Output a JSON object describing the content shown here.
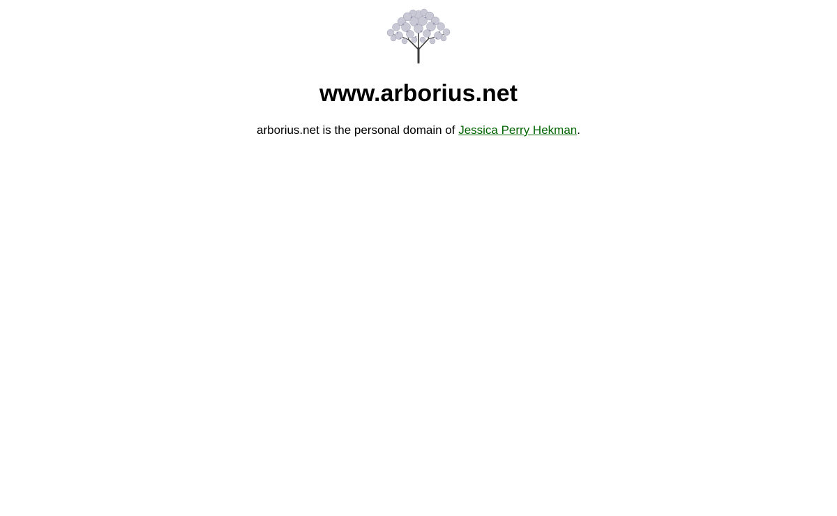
{
  "header": {
    "logo_icon": "tree-icon",
    "title": "www.arborius.net"
  },
  "intro": {
    "text_before": "arborius.net is the personal domain of ",
    "link_text": "Jessica Perry Hekman",
    "text_after": "."
  },
  "colors": {
    "background": "#ffffff",
    "text": "#000000",
    "link": "#006400",
    "tree_foliage": "#c9c9d6",
    "tree_trunk": "#3a3a3a"
  }
}
